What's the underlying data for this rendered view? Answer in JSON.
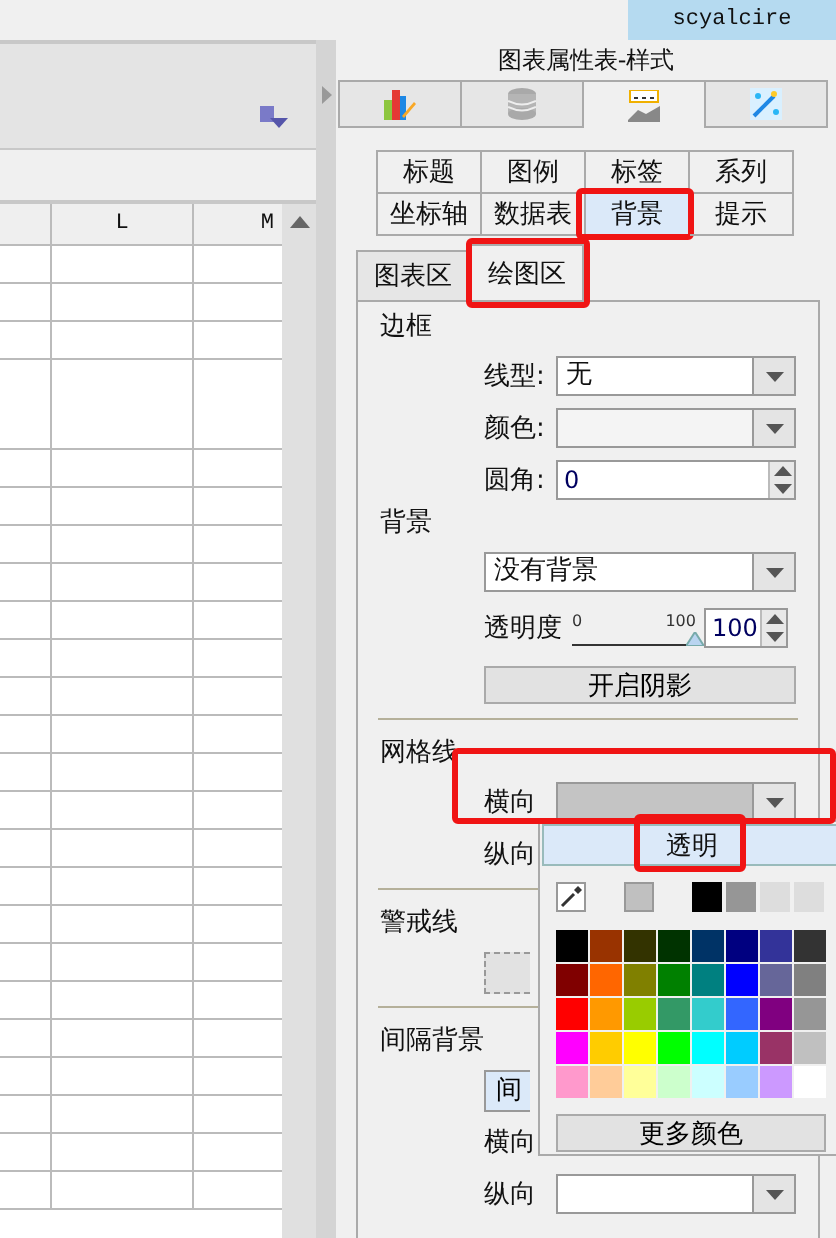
{
  "app_bar": {
    "user": "scyalcire"
  },
  "sheet": {
    "columns": [
      "L",
      "M"
    ]
  },
  "panel": {
    "title": "图表属性表-样式",
    "icon_tabs": [
      {
        "kind": "chart",
        "selected": false
      },
      {
        "kind": "database",
        "selected": false
      },
      {
        "kind": "label",
        "selected": true
      },
      {
        "kind": "magic",
        "selected": false
      }
    ],
    "sub_tabs": [
      {
        "label": "标题",
        "selected": false,
        "highlighted": false
      },
      {
        "label": "图例",
        "selected": false,
        "highlighted": false
      },
      {
        "label": "标签",
        "selected": false,
        "highlighted": false
      },
      {
        "label": "系列",
        "selected": false,
        "highlighted": false
      },
      {
        "label": "坐标轴",
        "selected": false,
        "highlighted": false
      },
      {
        "label": "数据表",
        "selected": false,
        "highlighted": false
      },
      {
        "label": "背景",
        "selected": true,
        "highlighted": true
      },
      {
        "label": "提示",
        "selected": false,
        "highlighted": false
      }
    ],
    "area_tabs": [
      {
        "label": "图表区",
        "selected": false,
        "highlighted": false
      },
      {
        "label": "绘图区",
        "selected": true,
        "highlighted": true
      }
    ]
  },
  "border": {
    "heading": "边框",
    "line_type": {
      "label": "线型:",
      "value": "无"
    },
    "color": {
      "label": "颜色:"
    },
    "corner": {
      "label": "圆角:",
      "value": "0"
    }
  },
  "background": {
    "heading": "背景",
    "fill": {
      "value": "没有背景"
    },
    "opacity": {
      "label": "透明度",
      "min": "0",
      "max": "100",
      "level": 1,
      "value": "100"
    },
    "shadow_button": "开启阴影"
  },
  "gridlines": {
    "heading": "网格线",
    "horizontal": {
      "label": "横向",
      "highlighted": true
    },
    "vertical": {
      "label": "纵向"
    }
  },
  "warning_line": {
    "heading": "警戒线"
  },
  "interval_background": {
    "heading": "间隔背景",
    "button": "间",
    "horizontal": {
      "label": "横向"
    },
    "vertical": {
      "label": "纵向"
    }
  },
  "color_popup": {
    "transparent_option": {
      "label": "透明",
      "highlighted": true
    },
    "recent": [
      {
        "color": "#c0c0c0"
      },
      {
        "color": "#000000"
      },
      {
        "color": "#969696"
      },
      {
        "color": "#dddddd"
      },
      {
        "color": "#dddddd"
      }
    ],
    "palette": [
      {
        "color": "#000000"
      },
      {
        "color": "#993300"
      },
      {
        "color": "#333300"
      },
      {
        "color": "#003300"
      },
      {
        "color": "#003366"
      },
      {
        "color": "#000080"
      },
      {
        "color": "#333399"
      },
      {
        "color": "#333333"
      },
      {
        "color": "#800000"
      },
      {
        "color": "#ff6600"
      },
      {
        "color": "#808000"
      },
      {
        "color": "#008000"
      },
      {
        "color": "#008080"
      },
      {
        "color": "#0000ff"
      },
      {
        "color": "#666699"
      },
      {
        "color": "#808080"
      },
      {
        "color": "#ff0000"
      },
      {
        "color": "#ff9900"
      },
      {
        "color": "#99cc00"
      },
      {
        "color": "#339966"
      },
      {
        "color": "#33cccc"
      },
      {
        "color": "#3366ff"
      },
      {
        "color": "#800080"
      },
      {
        "color": "#969696"
      },
      {
        "color": "#ff00ff"
      },
      {
        "color": "#ffcc00"
      },
      {
        "color": "#ffff00"
      },
      {
        "color": "#00ff00"
      },
      {
        "color": "#00ffff"
      },
      {
        "color": "#00ccff"
      },
      {
        "color": "#993366"
      },
      {
        "color": "#c0c0c0"
      },
      {
        "color": "#ff99cc"
      },
      {
        "color": "#ffcc99"
      },
      {
        "color": "#ffff99"
      },
      {
        "color": "#ccffcc"
      },
      {
        "color": "#ccffff"
      },
      {
        "color": "#99ccff"
      },
      {
        "color": "#cc99ff"
      },
      {
        "color": "#ffffff"
      }
    ],
    "more_button": "更多颜色"
  }
}
